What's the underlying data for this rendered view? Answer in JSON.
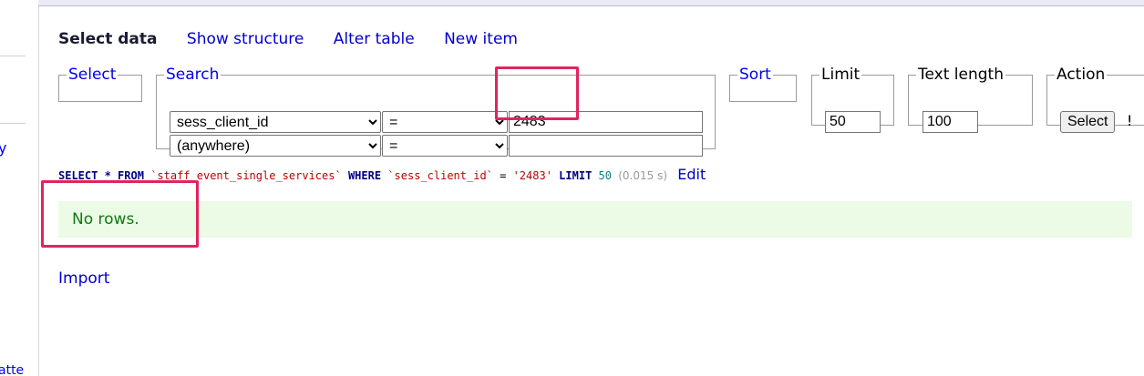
{
  "sidebar": {
    "fragment_1": "y",
    "fragment_2": "atte"
  },
  "tabs": [
    {
      "label": "Select data",
      "active": true
    },
    {
      "label": "Show structure",
      "active": false
    },
    {
      "label": "Alter table",
      "active": false
    },
    {
      "label": "New item",
      "active": false
    }
  ],
  "select_box": {
    "legend": "Select"
  },
  "search_box": {
    "legend": "Search",
    "row1": {
      "column": "sess_client_id",
      "operator": "=",
      "value": "2483"
    },
    "row2": {
      "column": "(anywhere)",
      "operator": "=",
      "value": ""
    }
  },
  "sort_box": {
    "legend": "Sort"
  },
  "limit_box": {
    "legend": "Limit",
    "value": "50"
  },
  "text_length_box": {
    "legend": "Text length",
    "value": "100"
  },
  "action_box": {
    "legend": "Action",
    "button": "Select",
    "extra": "!"
  },
  "sql": {
    "select": "SELECT",
    "star": " * ",
    "from": "FROM",
    "table": "`staff_event_single_services`",
    "where": "WHERE",
    "column": "`sess_client_id`",
    "eq": " = ",
    "value": "'2483'",
    "limit": "LIMIT",
    "limit_value": "50",
    "time": "(0.015 s)",
    "edit": "Edit"
  },
  "message": "No rows.",
  "import_link": "Import",
  "colors": {
    "highlight": "#e0245e",
    "link": "#0000cc",
    "success_bg": "#ebfbe6",
    "success_text": "#117a11"
  }
}
